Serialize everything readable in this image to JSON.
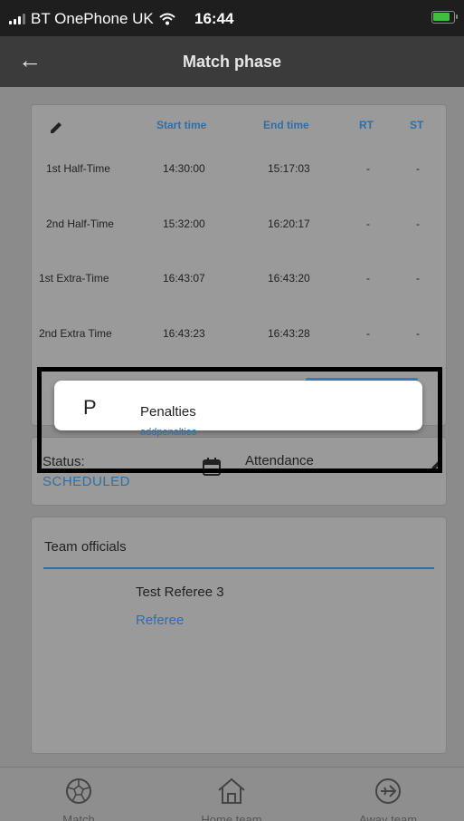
{
  "status_bar": {
    "carrier": "BT OnePhone UK",
    "time": "16:44"
  },
  "app_bar": {
    "back_icon": "arrow-left-icon",
    "title": "Match phase"
  },
  "times_card": {
    "headers": {
      "edit_icon": "pencil-icon",
      "start": "Start time",
      "end": "End time",
      "rt": "RT",
      "st": "ST"
    },
    "rows": [
      {
        "label": "1st Half-Time",
        "start": "14:30:00",
        "end": "15:17:03",
        "rt": "-",
        "st": "-"
      },
      {
        "label": "2nd Half-Time",
        "start": "15:32:00",
        "end": "16:20:17",
        "rt": "-",
        "st": "-"
      },
      {
        "label": "1st Extra-Time",
        "start": "16:43:07",
        "end": "16:43:20",
        "rt": "-",
        "st": "-"
      },
      {
        "label": "2nd Extra Time",
        "start": "16:43:23",
        "end": "16:43:28",
        "rt": "-",
        "st": "-"
      }
    ]
  },
  "popup": {
    "letter": "P",
    "title": "Penalties",
    "subtitle": "addpenalties"
  },
  "status_card": {
    "status_label": "Status:",
    "status_value": "SCHEDULED",
    "attendance_label": "Attendance"
  },
  "officials_card": {
    "title": "Team officials",
    "name": "Test Referee 3",
    "role": "Referee"
  },
  "bottom_nav": [
    {
      "label": "Match",
      "icon": "football-icon"
    },
    {
      "label": "Home team",
      "icon": "home-icon"
    },
    {
      "label": "Away team",
      "icon": "airplane-icon"
    }
  ],
  "colors": {
    "accent": "#2f6fa6",
    "appbar": "#3b3b3b",
    "scrim": "#8b8b8b"
  }
}
